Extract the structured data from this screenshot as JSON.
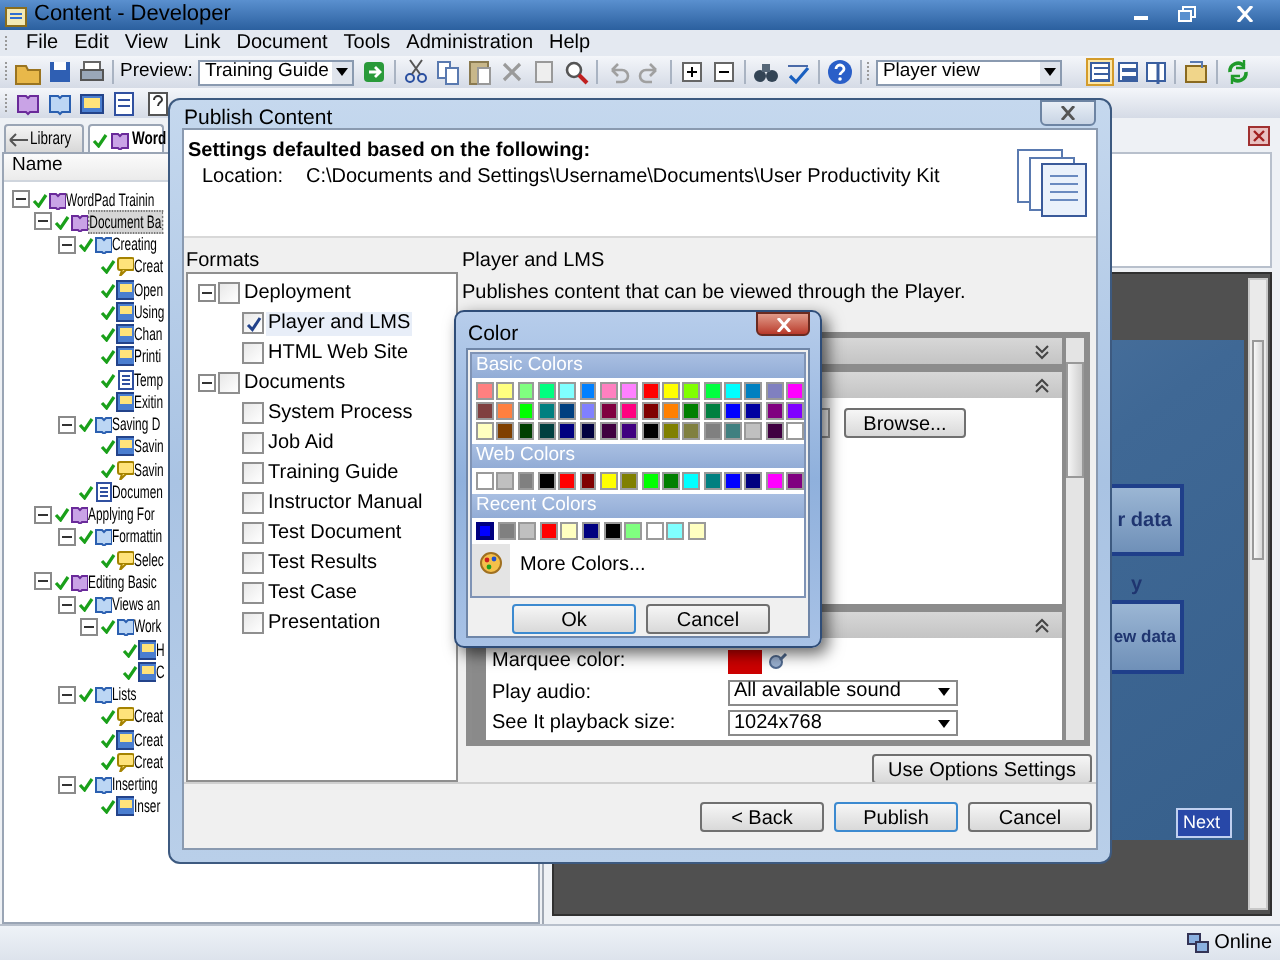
{
  "window": {
    "title": "Content - Developer"
  },
  "menu": [
    "File",
    "Edit",
    "View",
    "Link",
    "Document",
    "Tools",
    "Administration",
    "Help"
  ],
  "toolbar": {
    "preview_label": "Preview:",
    "preview_select": "Training Guide",
    "view_select": "Player view",
    "view_modes": [
      {
        "selected": true
      },
      {
        "selected": false
      },
      {
        "selected": false
      }
    ]
  },
  "library_tabs": [
    {
      "label": "Library",
      "selected": false
    },
    {
      "label": "Word",
      "selected": true
    }
  ],
  "outline": {
    "column": "Name",
    "nodes": [
      {
        "label": "WordPad Trainin",
        "kind": "book",
        "checked": true,
        "selected": false,
        "expanded": true,
        "children": [
          {
            "label": "Document Ba",
            "kind": "book",
            "checked": true,
            "selected": true,
            "expanded": true,
            "children": [
              {
                "label": "Creating",
                "kind": "module",
                "checked": true,
                "selected": false,
                "expanded": true,
                "children": [
                  {
                    "label": "Creat",
                    "kind": "topic",
                    "checked": true,
                    "selected": false
                  },
                  {
                    "label": "Open",
                    "kind": "topic-screen",
                    "checked": true,
                    "selected": false
                  },
                  {
                    "label": "Using",
                    "kind": "topic-screen",
                    "checked": true,
                    "selected": false
                  },
                  {
                    "label": "Chan",
                    "kind": "topic-screen",
                    "checked": true,
                    "selected": false
                  },
                  {
                    "label": "Printi",
                    "kind": "topic-screen",
                    "checked": true,
                    "selected": false
                  },
                  {
                    "label": "Temp",
                    "kind": "document",
                    "checked": true,
                    "selected": false
                  },
                  {
                    "label": "Exitin",
                    "kind": "topic-screen",
                    "checked": true,
                    "selected": false
                  }
                ]
              },
              {
                "label": "Saving D",
                "kind": "module",
                "checked": true,
                "selected": false,
                "expanded": true,
                "children": [
                  {
                    "label": "Savin",
                    "kind": "topic-screen",
                    "checked": true,
                    "selected": false
                  },
                  {
                    "label": "Savin",
                    "kind": "topic",
                    "checked": true,
                    "selected": false
                  }
                ]
              },
              {
                "label": "Documen",
                "kind": "document",
                "checked": true,
                "selected": false
              }
            ]
          },
          {
            "label": "Applying For",
            "kind": "book",
            "checked": true,
            "selected": false,
            "expanded": true,
            "children": [
              {
                "label": "Formattin",
                "kind": "module",
                "checked": true,
                "selected": false,
                "expanded": true,
                "children": [
                  {
                    "label": "Selec",
                    "kind": "topic",
                    "checked": true,
                    "selected": false
                  }
                ]
              }
            ]
          },
          {
            "label": "Editing Basic",
            "kind": "book",
            "checked": true,
            "selected": false,
            "expanded": true,
            "children": [
              {
                "label": "Views an",
                "kind": "module",
                "checked": true,
                "selected": false,
                "expanded": true,
                "children": [
                  {
                    "label": "Work",
                    "kind": "module",
                    "checked": true,
                    "selected": false,
                    "expanded": true,
                    "children": [
                      {
                        "label": "H",
                        "kind": "topic-screen",
                        "checked": true,
                        "selected": false
                      },
                      {
                        "label": "C",
                        "kind": "topic-screen",
                        "checked": true,
                        "selected": false
                      }
                    ]
                  }
                ]
              },
              {
                "label": "Lists",
                "kind": "module",
                "checked": true,
                "selected": false,
                "expanded": true,
                "children": [
                  {
                    "label": "Creat",
                    "kind": "topic",
                    "checked": true,
                    "selected": false
                  },
                  {
                    "label": "Creat",
                    "kind": "topic-screen",
                    "checked": true,
                    "selected": false
                  },
                  {
                    "label": "Creat",
                    "kind": "topic",
                    "checked": true,
                    "selected": false
                  }
                ]
              },
              {
                "label": "Inserting",
                "kind": "module",
                "checked": true,
                "selected": false,
                "expanded": true,
                "children": [
                  {
                    "label": "Inser",
                    "kind": "topic-screen",
                    "checked": true,
                    "selected": false
                  }
                ]
              }
            ]
          }
        ]
      }
    ]
  },
  "preview": {
    "boxes": [
      "r data",
      "ew data"
    ],
    "note": "y",
    "next_button": "Next"
  },
  "status_bar": {
    "status": "Online"
  },
  "publish_dialog": {
    "title": "Publish Content",
    "heading": "Settings defaulted based on the following:",
    "location_label": "Location:",
    "location": "C:\\Documents and Settings\\Username\\Documents\\User Productivity Kit",
    "formats_label": "Formats",
    "formats": [
      {
        "label": "Deployment",
        "checked": false,
        "selected": false,
        "expanded": true,
        "children": [
          {
            "label": "Player and LMS",
            "checked": true,
            "selected": true
          },
          {
            "label": "HTML Web Site",
            "checked": false,
            "selected": false
          }
        ]
      },
      {
        "label": "Documents",
        "checked": false,
        "selected": false,
        "expanded": true,
        "children": [
          {
            "label": "System Process",
            "checked": false,
            "selected": false
          },
          {
            "label": "Job Aid",
            "checked": false,
            "selected": false
          },
          {
            "label": "Training Guide",
            "checked": false,
            "selected": false
          },
          {
            "label": "Instructor Manual",
            "checked": false,
            "selected": false
          },
          {
            "label": "Test Document",
            "checked": false,
            "selected": false
          },
          {
            "label": "Test Results",
            "checked": false,
            "selected": false
          },
          {
            "label": "Test Case",
            "checked": false,
            "selected": false
          },
          {
            "label": "Presentation",
            "checked": false,
            "selected": false
          }
        ]
      }
    ],
    "detail_title": "Player and LMS",
    "detail_description": "Publishes content that can be viewed through the Player.",
    "sections": [
      {
        "expanded": false
      },
      {
        "expanded": true,
        "browse_button": "Browse..."
      },
      {
        "expanded": true,
        "rows": [
          {
            "label": "Marquee color:",
            "kind": "color",
            "color": "#cc0000"
          },
          {
            "label": "Play audio:",
            "kind": "select",
            "value": "All available sound"
          },
          {
            "label": "See It playback size:",
            "kind": "select",
            "value": "1024x768"
          }
        ]
      }
    ],
    "options_button": "Use Options Settings",
    "buttons": [
      {
        "label": "< Back",
        "default": false
      },
      {
        "label": "Publish",
        "default": true
      },
      {
        "label": "Cancel",
        "default": false
      }
    ]
  },
  "color_dialog": {
    "title": "Color",
    "groups": [
      {
        "label": "Basic Colors",
        "rows": [
          [
            {
              "color": "#ff8080",
              "selected": false
            },
            {
              "color": "#ffff80",
              "selected": false
            },
            {
              "color": "#80ff80",
              "selected": false
            },
            {
              "color": "#00ff80",
              "selected": false
            },
            {
              "color": "#80ffff",
              "selected": false
            },
            {
              "color": "#0080ff",
              "selected": false
            },
            {
              "color": "#ff80c0",
              "selected": false
            },
            {
              "color": "#ff80ff",
              "selected": false
            },
            {
              "color": "#ff0000",
              "selected": false
            },
            {
              "color": "#ffff00",
              "selected": false
            },
            {
              "color": "#80ff00",
              "selected": false
            },
            {
              "color": "#00ff40",
              "selected": false
            },
            {
              "color": "#00ffff",
              "selected": false
            },
            {
              "color": "#0080c0",
              "selected": false
            },
            {
              "color": "#8080c0",
              "selected": false
            },
            {
              "color": "#ff00ff",
              "selected": false
            }
          ],
          [
            {
              "color": "#804040",
              "selected": false
            },
            {
              "color": "#ff8040",
              "selected": false
            },
            {
              "color": "#00ff00",
              "selected": false
            },
            {
              "color": "#008080",
              "selected": false
            },
            {
              "color": "#004080",
              "selected": false
            },
            {
              "color": "#8080ff",
              "selected": false
            },
            {
              "color": "#800040",
              "selected": false
            },
            {
              "color": "#ff0080",
              "selected": false
            },
            {
              "color": "#800000",
              "selected": false
            },
            {
              "color": "#ff8000",
              "selected": false
            },
            {
              "color": "#008000",
              "selected": false
            },
            {
              "color": "#008040",
              "selected": false
            },
            {
              "color": "#0000ff",
              "selected": false
            },
            {
              "color": "#0000a0",
              "selected": false
            },
            {
              "color": "#800080",
              "selected": false
            },
            {
              "color": "#8000ff",
              "selected": false
            }
          ],
          [
            {
              "color": "#ffffc0",
              "selected": false
            },
            {
              "color": "#804000",
              "selected": false
            },
            {
              "color": "#004000",
              "selected": false
            },
            {
              "color": "#004040",
              "selected": false
            },
            {
              "color": "#000080",
              "selected": false
            },
            {
              "color": "#000040",
              "selected": false
            },
            {
              "color": "#400040",
              "selected": false
            },
            {
              "color": "#400080",
              "selected": false
            },
            {
              "color": "#000000",
              "selected": false
            },
            {
              "color": "#808000",
              "selected": false
            },
            {
              "color": "#808040",
              "selected": false
            },
            {
              "color": "#808080",
              "selected": false
            },
            {
              "color": "#408080",
              "selected": false
            },
            {
              "color": "#c0c0c0",
              "selected": false
            },
            {
              "color": "#400041",
              "selected": false
            },
            {
              "color": "#ffffff",
              "selected": false
            }
          ]
        ]
      },
      {
        "label": "Web Colors",
        "rows": [
          [
            {
              "color": "#ffffff",
              "selected": false
            },
            {
              "color": "#c0c0c0",
              "selected": false
            },
            {
              "color": "#808080",
              "selected": false
            },
            {
              "color": "#000000",
              "selected": false
            },
            {
              "color": "#ff0000",
              "selected": false
            },
            {
              "color": "#800000",
              "selected": false
            },
            {
              "color": "#ffff00",
              "selected": false
            },
            {
              "color": "#808000",
              "selected": false
            },
            {
              "color": "#00ff00",
              "selected": false
            },
            {
              "color": "#008000",
              "selected": false
            },
            {
              "color": "#00ffff",
              "selected": false
            },
            {
              "color": "#008080",
              "selected": false
            },
            {
              "color": "#0000ff",
              "selected": false
            },
            {
              "color": "#000080",
              "selected": false
            },
            {
              "color": "#ff00ff",
              "selected": false
            },
            {
              "color": "#800080",
              "selected": false
            }
          ]
        ]
      },
      {
        "label": "Recent Colors",
        "rows": [
          [
            {
              "color": "#0000ff",
              "selected": true
            },
            {
              "color": "#808080",
              "selected": false
            },
            {
              "color": "#c0c0c0",
              "selected": false
            },
            {
              "color": "#ff0000",
              "selected": false
            },
            {
              "color": "#ffffc0",
              "selected": false
            },
            {
              "color": "#000080",
              "selected": false
            },
            {
              "color": "#000000",
              "selected": false
            },
            {
              "color": "#80ff80",
              "selected": false
            },
            {
              "color": "#ffffff",
              "selected": false
            },
            {
              "color": "#80ffff",
              "selected": false
            },
            {
              "color": "#ffffc1",
              "selected": false
            }
          ]
        ]
      }
    ],
    "more_colors": "More Colors...",
    "buttons": [
      {
        "label": "Ok",
        "default": true
      },
      {
        "label": "Cancel",
        "default": false
      }
    ]
  }
}
